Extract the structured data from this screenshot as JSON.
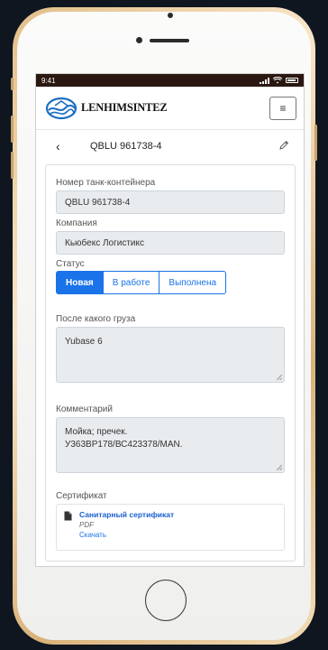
{
  "status_bar": {
    "time": "9:41"
  },
  "brand": {
    "name": "LENHIMSINTEZ"
  },
  "navbar": {
    "menu_icon": "hamburger-icon"
  },
  "header": {
    "back_icon": "chevron-left-icon",
    "title": "QBLU 961738-4",
    "edit_icon": "pencil-icon"
  },
  "form": {
    "container_label": "Номер танк-контейнера",
    "container_value": "QBLU 961738-4",
    "company_label": "Компания",
    "company_value": "Кьюбекс Логистикс",
    "status_label": "Статус",
    "status_options": [
      "Новая",
      "В работе",
      "Выполнена"
    ],
    "status_selected": "Новая",
    "cargo_label": "После какого груза",
    "cargo_value": "Yubase 6",
    "comment_label": "Комментарий",
    "comment_line1": "Мойка; пречек.",
    "comment_line2": "У363ВР178/ВС423378/MAN.",
    "certificate_label": "Сертификат",
    "certificate": {
      "title": "Санитарный сертификат",
      "type": "PDF",
      "download": "Скачать",
      "icon": "file-icon"
    }
  },
  "colors": {
    "primary": "#1a73e8",
    "status_bar": "#2a1712",
    "field_bg": "#e9ecef"
  }
}
